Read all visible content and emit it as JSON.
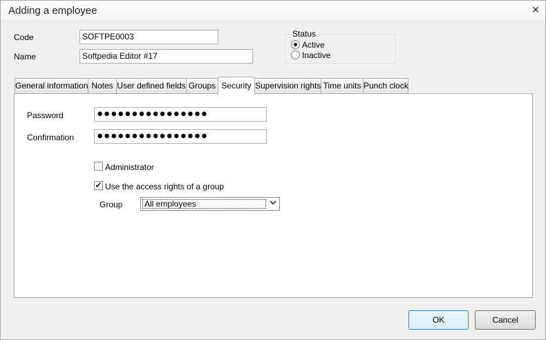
{
  "window": {
    "title": "Adding a employee",
    "close_glyph": "✕"
  },
  "fields": {
    "code_label": "Code",
    "code_value": "SOFTPE0003",
    "name_label": "Name",
    "name_value": "Softpedia Editor #17"
  },
  "status": {
    "legend": "Status",
    "options": [
      {
        "label": "Active",
        "checked": true
      },
      {
        "label": "Inactive",
        "checked": false
      }
    ]
  },
  "tabs": [
    {
      "label": "General information"
    },
    {
      "label": "Notes"
    },
    {
      "label": "User defined fields"
    },
    {
      "label": "Groups"
    },
    {
      "label": "Security",
      "active": true
    },
    {
      "label": "Supervision rights"
    },
    {
      "label": "Time units"
    },
    {
      "label": "Punch clock"
    }
  ],
  "security": {
    "password_label": "Password",
    "password_value": "●●●●●●●●●●●●●●●●",
    "confirmation_label": "Confirmation",
    "confirmation_value": "●●●●●●●●●●●●●●●●",
    "administrator_label": "Administrator",
    "administrator_checked": false,
    "access_rights_label": "Use the access rights of a group",
    "access_rights_checked": true,
    "group_label": "Group",
    "group_value": "All employees"
  },
  "buttons": {
    "ok": "OK",
    "cancel": "Cancel"
  },
  "icons": {
    "check": "check-icon",
    "dropdown": "chevron-down-icon",
    "close": "close-icon"
  }
}
